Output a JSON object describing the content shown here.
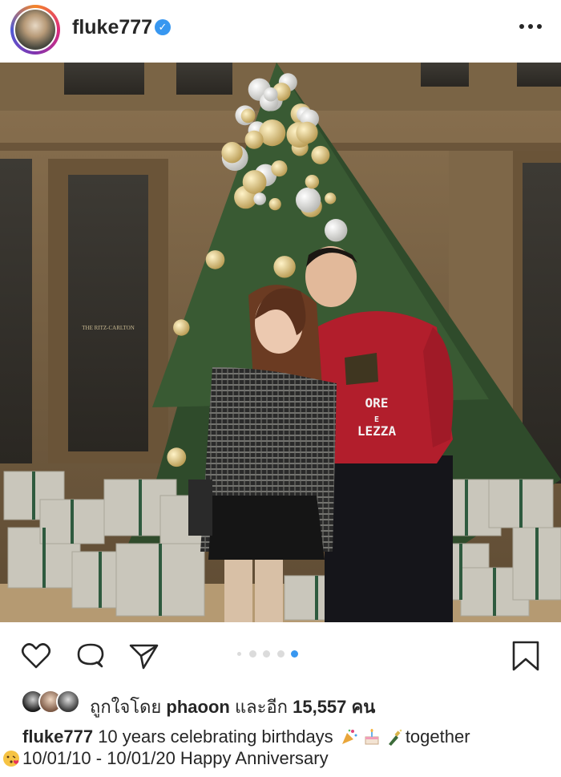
{
  "post": {
    "username": "fluke777",
    "verified_mark": "✓",
    "more_icon": "more-horizontal-icon"
  },
  "photo": {
    "description_icon": "photo",
    "sign_text": "THE RITZ-CARLTON",
    "sweater_text_line1": "ORE",
    "sweater_text_line2": "E",
    "sweater_text_line3": "LEZZA"
  },
  "actions": {
    "like_icon": "heart-icon",
    "comment_icon": "comment-icon",
    "share_icon": "send-icon",
    "save_icon": "bookmark-icon",
    "carousel_count": 4,
    "carousel_active_index": 3
  },
  "likes": {
    "prefix": "ถูกใจโดย",
    "first_user": "phaoon",
    "middle": "และอีก",
    "count": "15,557",
    "suffix": "คน"
  },
  "caption": {
    "username": "fluke777",
    "line1_text": "10 years celebrating birthdays",
    "line1_end": "together",
    "line2_text": "10/01/10 - 10/01/20 Happy Anniversary"
  },
  "colors": {
    "accent": "#3897f0",
    "text": "#262626",
    "dot_inactive": "#dbdbdb"
  }
}
